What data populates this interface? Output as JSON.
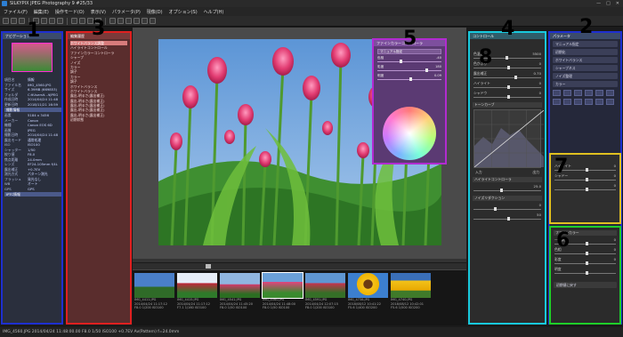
{
  "window": {
    "title": "SILKYPIX JPEG Photography 9   #25/33",
    "controls": [
      "—",
      "□",
      "✕"
    ]
  },
  "menu": [
    "ファイル(F)",
    "編集(E)",
    "操作モード(O)",
    "表示(V)",
    "パラメータ(P)",
    "現像(D)",
    "オプション(S)",
    "ヘルプ(H)"
  ],
  "left_panel": {
    "header": "ナビゲーション",
    "meta": [
      {
        "k": "項目名",
        "v": "情報"
      },
      {
        "k": "ファイル名",
        "v": "IMG_4560.JPG"
      },
      {
        "k": "サイズ",
        "v": "6.39MB (669853)"
      },
      {
        "k": "フォルダ",
        "v": "C:¥Users¥...¥JPEG"
      },
      {
        "k": "作成日時",
        "v": "2014/04/24 11:48"
      },
      {
        "k": "更新日時",
        "v": "2018/11/21 16:59"
      },
      {
        "k": "撮影",
        "v": "撮影情報"
      },
      {
        "k": "画素",
        "v": "5184 x 3456"
      },
      {
        "k": "メーカー",
        "v": "Canon"
      },
      {
        "k": "機種",
        "v": "Canon EOS 6D"
      },
      {
        "k": "画質",
        "v": "JPEG"
      },
      {
        "k": "撮影日時",
        "v": "2014/04/24 11:48"
      },
      {
        "k": "露出モード",
        "v": "通常処理"
      },
      {
        "k": "ISO",
        "v": "ISO100"
      },
      {
        "k": "シャッター",
        "v": "1/50"
      },
      {
        "k": "絞り値",
        "v": "F8.0"
      },
      {
        "k": "焦点距離",
        "v": "24.0mm"
      },
      {
        "k": "レンズ",
        "v": "EF24-105mm f/4L"
      },
      {
        "k": "露出補正",
        "v": "+0.7EV"
      },
      {
        "k": "測光方式",
        "v": "パターン測光"
      },
      {
        "k": "フラッシュ",
        "v": "発光なし"
      },
      {
        "k": "WB",
        "v": "オート"
      },
      {
        "k": "GPS",
        "v": "GPS"
      }
    ],
    "section2": "IPTC情報"
  },
  "tool_panel": {
    "header": "編集履歴",
    "items": [
      "ホワイトバランス調整",
      "ハイライトコントロール",
      "ファインカラーコントローラ",
      "シャープ",
      "ノイズ",
      "カラー",
      "調子",
      "カラー",
      "調子",
      "ホワイトバランス",
      "ホワイトバランス",
      "露出-明るさ(露出補正)",
      "露出-明るさ(露出補正)",
      "露出-明るさ(露出補正)",
      "露出-明るさ(露出補正)",
      "露出-明るさ(露出補正)",
      "初期状態"
    ],
    "selected_index": 0
  },
  "viewer": {
    "zoom": "",
    "image": "tulips-photo"
  },
  "filmstrip": [
    {
      "name": "IMG_4411.JPG",
      "date": "2014/04/24 11:17:12",
      "exp": "F8.0 1/200 ISO100"
    },
    {
      "name": "IMG_4415.JPG",
      "date": "2014/04/24 11:17:12",
      "exp": "F7.1 1/160 ISO100"
    },
    {
      "name": "IMG_4541.JPG",
      "date": "2014/04/24 11:45:20",
      "exp": "F8.0 1/50 ISO100"
    },
    {
      "name": "IMG_4560.JPG",
      "date": "2014/04/24 11:48:00",
      "exp": "F8.0 1/50 ISO100"
    },
    {
      "name": "IMG_4591.JPG",
      "date": "2014/04/24 12:07:15",
      "exp": "F8.0 1/200 ISO100"
    },
    {
      "name": "IMG_4738.JPG",
      "date": "2018/08/12 10:41:22",
      "exp": "F5.6 1/400 ISO200"
    },
    {
      "name": "IMG_4740.JPG",
      "date": "2018/08/12 10:42:01",
      "exp": "F5.6 1/500 ISO200"
    }
  ],
  "filmstrip_selected": 3,
  "statusbar": "IMG_4560.JPG 2014/04/24 11:48:00.00 F8.0 1/50 ISO100 +0.7EV Av(Pattern) f=24.0mm",
  "adjust_panel": {
    "header": "コントロール",
    "sliders": [
      {
        "label": "色温度",
        "value": "5500"
      },
      {
        "label": "色かぶり",
        "value": "0"
      },
      {
        "label": "露出補正",
        "value": "0.70"
      },
      {
        "label": "ハイライト",
        "value": "0"
      },
      {
        "label": "シャドウ",
        "value": "0"
      }
    ],
    "curve_head": "トーンカーブ",
    "curve_labels": [
      "入力",
      "出力"
    ],
    "sub_heads": [
      "ハイライトコントローラ",
      "ノイズリダクション"
    ],
    "bottom_values": [
      "25.0",
      "0",
      "50"
    ]
  },
  "right_panel": {
    "header": "パラメータ",
    "rows": [
      "マニュアル指定",
      "初期化",
      "ホワイトバランス",
      "シャープネス",
      "ノイズ整理",
      "カラー"
    ],
    "icons": 18
  },
  "yellow_box": {
    "labels": [
      "ハイライト",
      "シャドー"
    ],
    "values": [
      "0",
      "0",
      "0"
    ]
  },
  "green_box": {
    "head": "ファインカラー",
    "labels": [
      "一括調整",
      "色相",
      "彩度",
      "明度",
      "初期値に戻す"
    ],
    "values": [
      "0",
      "0",
      "0"
    ]
  },
  "purple_box": {
    "head": "ファインカラーコントローラ",
    "field": "マニュアル指定",
    "sliders": [
      {
        "label": "色相",
        "value": "-40",
        "pos": 0.35
      },
      {
        "label": "彩度",
        "value": "180",
        "pos": 0.75
      },
      {
        "label": "明度",
        "value": "0.09",
        "pos": 0.5
      }
    ]
  },
  "annotations": [
    "1",
    "2",
    "3",
    "4",
    "5",
    "6",
    "7",
    "8"
  ]
}
